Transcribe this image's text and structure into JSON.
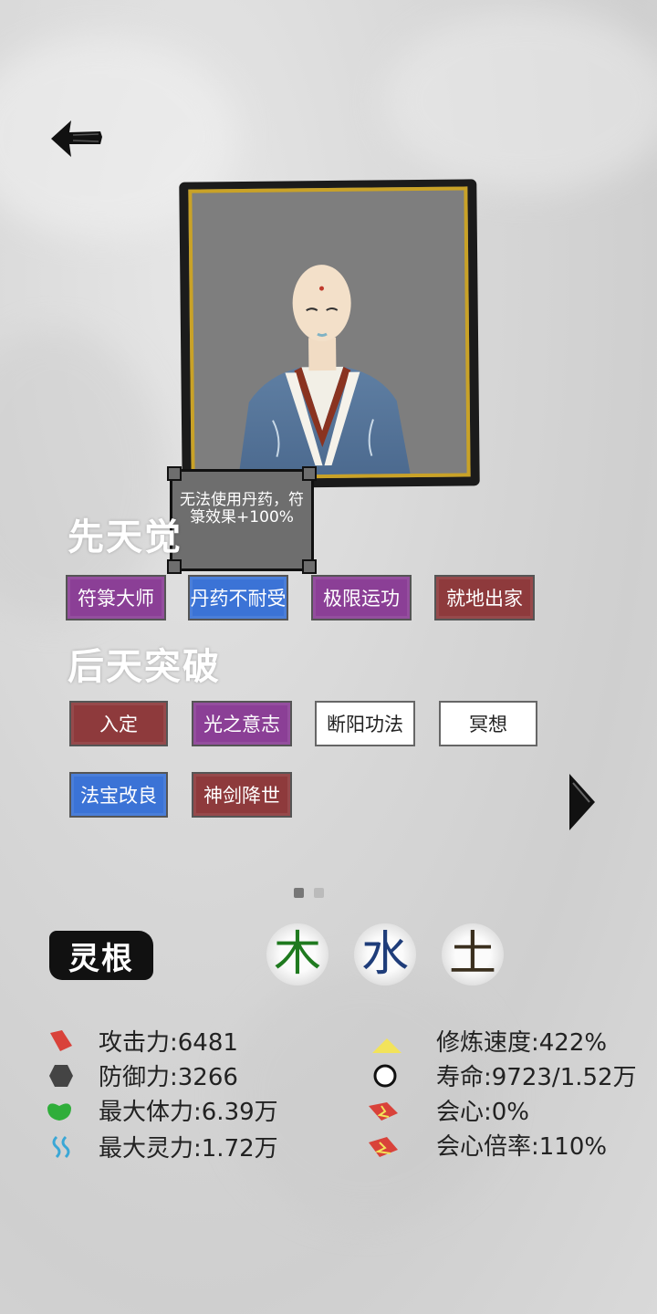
{
  "tooltip": {
    "text": "无法使用丹药，符箓效果+100%"
  },
  "innate": {
    "title": "先天觉",
    "skills": [
      {
        "label": "符箓大师",
        "style": "purple"
      },
      {
        "label": "丹药不耐受",
        "style": "blue"
      },
      {
        "label": "极限运功",
        "style": "purple"
      },
      {
        "label": "就地出家",
        "style": "red"
      }
    ]
  },
  "acquired": {
    "title": "后天突破",
    "skills": [
      {
        "label": "入定",
        "style": "red"
      },
      {
        "label": "光之意志",
        "style": "purple"
      },
      {
        "label": "断阳功法",
        "style": "white"
      },
      {
        "label": "冥想",
        "style": "white"
      },
      {
        "label": "法宝改良",
        "style": "blue"
      },
      {
        "label": "神剑降世",
        "style": "red"
      }
    ]
  },
  "pager": {
    "pages": 2,
    "current": 1
  },
  "spirit_root": {
    "label": "灵根",
    "elements": [
      {
        "char": "木",
        "color": "#1f7a1f"
      },
      {
        "char": "水",
        "color": "#1f3d7a"
      },
      {
        "char": "土",
        "color": "#3a2f1e"
      }
    ]
  },
  "stats": {
    "attack": "攻击力:6481",
    "defense": "防御力:3266",
    "max_hp": "最大体力:6.39万",
    "max_sp": "最大灵力:1.72万",
    "cultivation_speed": "修炼速度:422%",
    "lifespan": "寿命:9723/1.52万",
    "crit": "会心:0%",
    "crit_mult": "会心倍率:110%"
  },
  "colors": {
    "attack_icon": "#d9423a",
    "defense_icon": "#444444",
    "hp_icon": "#2fae3a",
    "sp_icon": "#3aa7d6",
    "speed_icon": "#f2e35a",
    "crit_icon": "#d9423a"
  }
}
